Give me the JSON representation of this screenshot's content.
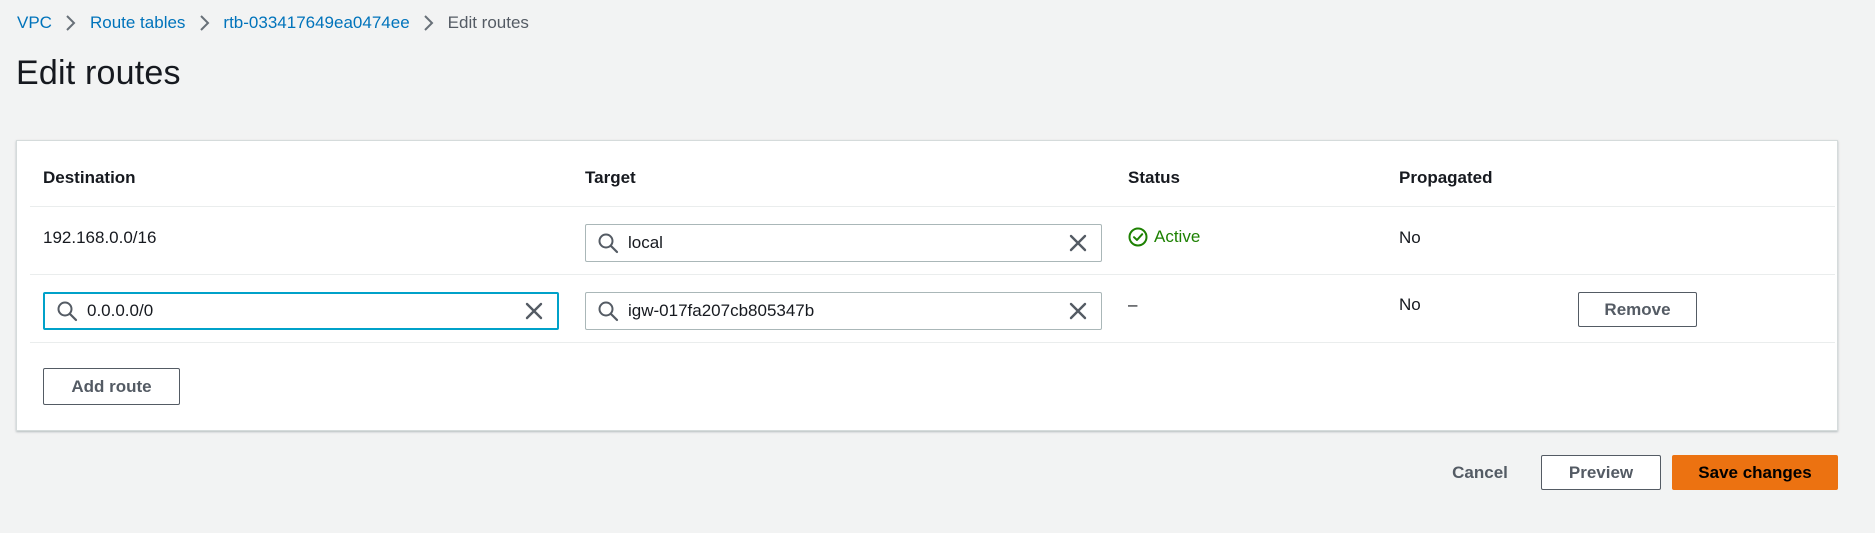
{
  "breadcrumb": {
    "items": [
      "VPC",
      "Route tables",
      "rtb-033417649ea0474ee"
    ],
    "current": "Edit routes"
  },
  "page": {
    "title": "Edit routes"
  },
  "table": {
    "headers": {
      "destination": "Destination",
      "target": "Target",
      "status": "Status",
      "propagated": "Propagated"
    },
    "rows": [
      {
        "destination": "192.168.0.0/16",
        "target": "local",
        "status": "Active",
        "propagated": "No"
      },
      {
        "destination": "0.0.0.0/0",
        "target": "igw-017fa207cb805347b",
        "status": "–",
        "propagated": "No",
        "remove_label": "Remove"
      }
    ]
  },
  "actions": {
    "add_route": "Add route",
    "cancel": "Cancel",
    "preview": "Preview",
    "save": "Save changes"
  },
  "colors": {
    "link": "#0073bb",
    "success": "#1d8102",
    "primary": "#ec7211",
    "focus": "#00a1c9"
  },
  "icons": [
    "chevron-right-icon",
    "search-icon",
    "close-icon",
    "status-success-icon"
  ]
}
